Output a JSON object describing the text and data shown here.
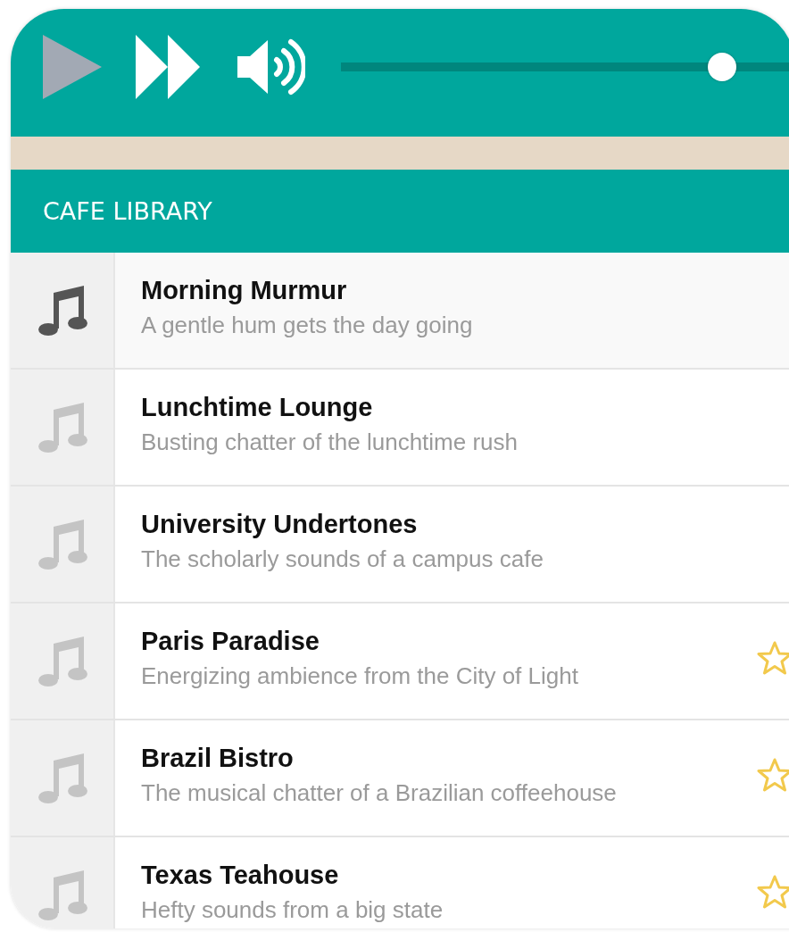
{
  "player": {
    "play_disabled": true,
    "volume": {
      "level": 0.84
    }
  },
  "library": {
    "title": "CAFE LIBRARY",
    "tracks": [
      {
        "title": "Morning Murmur",
        "description": "A gentle hum gets the day going",
        "selected": true,
        "favorite": false
      },
      {
        "title": "Lunchtime Lounge",
        "description": "Busting chatter of the lunchtime rush",
        "selected": false,
        "favorite": false
      },
      {
        "title": "University Undertones",
        "description": "The scholarly sounds of a campus cafe",
        "selected": false,
        "favorite": false
      },
      {
        "title": "Paris Paradise",
        "description": "Energizing ambience from the City of Light",
        "selected": false,
        "favorite": true
      },
      {
        "title": "Brazil Bistro",
        "description": "The musical chatter of a Brazilian coffeehouse",
        "selected": false,
        "favorite": true
      },
      {
        "title": "Texas Teahouse",
        "description": "Hefty sounds from a big state",
        "selected": false,
        "favorite": true
      }
    ]
  }
}
